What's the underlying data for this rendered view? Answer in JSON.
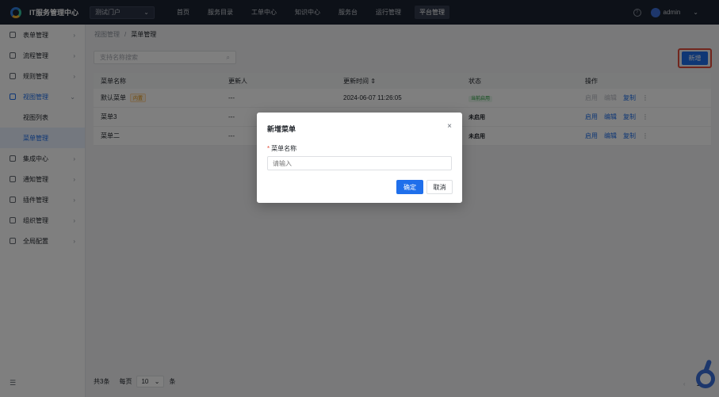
{
  "app_title": "IT服务管理中心",
  "portal_select": "测试门户",
  "nav": [
    "首页",
    "服务目录",
    "工单中心",
    "知识中心",
    "服务台",
    "运行管理",
    "平台管理"
  ],
  "nav_active": "平台管理",
  "user": "admin",
  "sidebar": {
    "items": [
      "表单管理",
      "流程管理",
      "规则管理",
      "视图管理",
      "视图列表",
      "菜单管理",
      "集成中心",
      "通知管理",
      "插件管理",
      "组织管理",
      "全局配置"
    ]
  },
  "breadcrumb": [
    "视图管理",
    "菜单管理"
  ],
  "search_placeholder": "支持名称搜索",
  "add_label": "新增",
  "table": {
    "headers": [
      "菜单名称",
      "更新人",
      "更新时间",
      "状态",
      "操作"
    ],
    "rows": [
      {
        "name": "默认菜单",
        "tag": "内置",
        "updater": "---",
        "time": "2024-06-07 11:26:05",
        "status": "当前启用",
        "actions": [
          "启用",
          "编辑",
          "复制"
        ],
        "more": "⋮"
      },
      {
        "name": "菜单3",
        "tag": "",
        "updater": "---",
        "time": "",
        "status": "未启用",
        "actions": [
          "启用",
          "编辑",
          "复制"
        ],
        "more": "⋮"
      },
      {
        "name": "菜单二",
        "tag": "",
        "updater": "---",
        "time": "",
        "status": "未启用",
        "actions": [
          "启用",
          "编辑",
          "复制"
        ],
        "more": "⋮"
      }
    ]
  },
  "pager": {
    "total": "共3条",
    "per_page_label": "每页",
    "page_size": "10",
    "unit": "条",
    "current": "1"
  },
  "modal": {
    "title": "新增菜单",
    "field_label": "菜单名称",
    "input_placeholder": "请输入",
    "ok": "确定",
    "cancel": "取消",
    "close": "×"
  }
}
